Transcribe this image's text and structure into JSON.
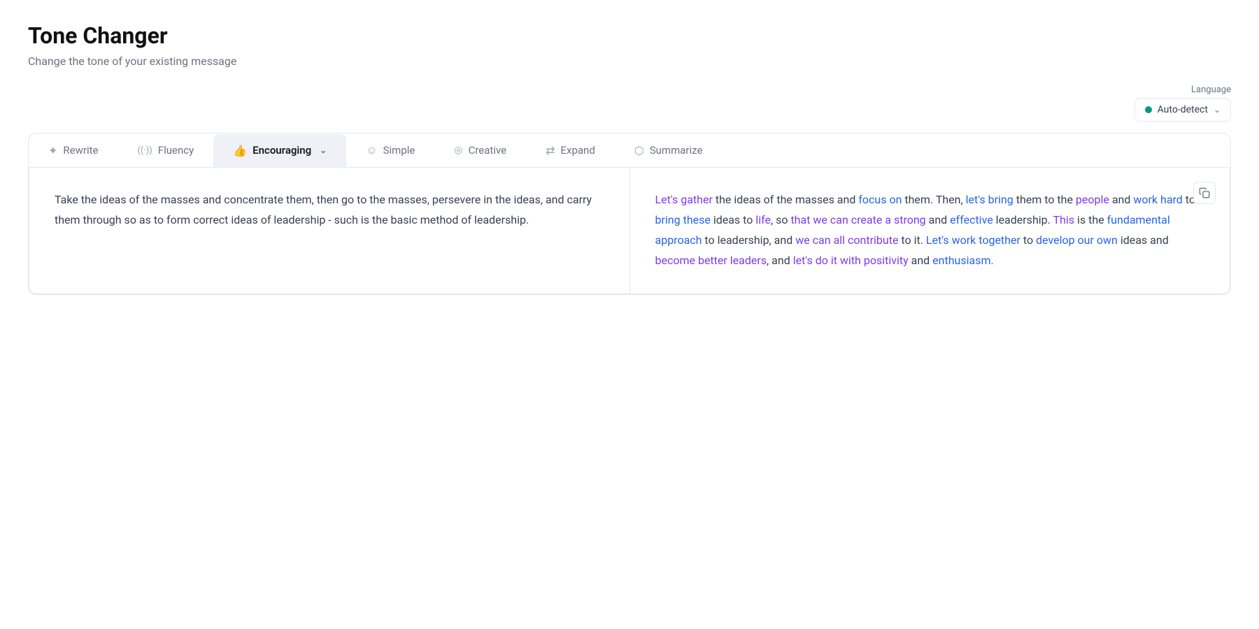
{
  "header": {
    "title": "Tone Changer",
    "subtitle": "Change the tone of your existing message"
  },
  "language": {
    "label": "Language",
    "selected": "Auto-detect",
    "dot_color": "#0d9488"
  },
  "tabs": [
    {
      "id": "rewrite",
      "label": "Rewrite",
      "icon": "✦",
      "active": false
    },
    {
      "id": "fluency",
      "label": "Fluency",
      "icon": "◉",
      "active": false
    },
    {
      "id": "encouraging",
      "label": "Encouraging",
      "icon": "👍",
      "active": true,
      "has_dropdown": true
    },
    {
      "id": "simple",
      "label": "Simple",
      "icon": "☺",
      "active": false
    },
    {
      "id": "creative",
      "label": "Creative",
      "icon": "◎",
      "active": false
    },
    {
      "id": "expand",
      "label": "Expand",
      "icon": "⇄",
      "active": false
    },
    {
      "id": "summarize",
      "label": "Summarize",
      "icon": "⬡",
      "active": false
    }
  ],
  "original": {
    "text": "Take the ideas of the masses and concentrate them, then go to the masses, persevere in the ideas, and carry them through so as to form correct ideas of leadership - such is the basic method of leadership."
  },
  "result": {
    "segments": [
      {
        "text": "Let's gather",
        "style": "purple"
      },
      {
        "text": " the ideas of the masses and ",
        "style": "normal"
      },
      {
        "text": "focus on",
        "style": "blue"
      },
      {
        "text": " them. Then, ",
        "style": "normal"
      },
      {
        "text": "let's bring",
        "style": "blue"
      },
      {
        "text": " them to the ",
        "style": "normal"
      },
      {
        "text": "people",
        "style": "purple"
      },
      {
        "text": " and ",
        "style": "normal"
      },
      {
        "text": "work hard",
        "style": "blue"
      },
      {
        "text": " to ",
        "style": "normal"
      },
      {
        "text": "bring these",
        "style": "blue"
      },
      {
        "text": " ideas to ",
        "style": "normal"
      },
      {
        "text": "life",
        "style": "purple"
      },
      {
        "text": ", so ",
        "style": "normal"
      },
      {
        "text": "that we can create a strong",
        "style": "purple"
      },
      {
        "text": " and ",
        "style": "normal"
      },
      {
        "text": "effective",
        "style": "blue"
      },
      {
        "text": " leadership. ",
        "style": "normal"
      },
      {
        "text": "This",
        "style": "purple"
      },
      {
        "text": " is the ",
        "style": "normal"
      },
      {
        "text": "fundamental approach",
        "style": "blue"
      },
      {
        "text": " to leadership, and ",
        "style": "normal"
      },
      {
        "text": "we can all contribute",
        "style": "purple"
      },
      {
        "text": " to it. ",
        "style": "normal"
      },
      {
        "text": "Let's work together",
        "style": "blue"
      },
      {
        "text": " to ",
        "style": "normal"
      },
      {
        "text": "develop our own",
        "style": "blue"
      },
      {
        "text": " ideas and ",
        "style": "normal"
      },
      {
        "text": "become better leaders",
        "style": "purple"
      },
      {
        "text": ", and ",
        "style": "normal"
      },
      {
        "text": "let's do it with positivity",
        "style": "purple"
      },
      {
        "text": " and ",
        "style": "normal"
      },
      {
        "text": "enthusiasm.",
        "style": "blue"
      }
    ]
  },
  "icons": {
    "copy": "⧉",
    "chevron_down": "∨",
    "rewrite": "✦",
    "fluency": "◉",
    "encouraging": "👍",
    "simple": "☺",
    "creative": "◎",
    "expand": "⇄",
    "summarize": "⬡"
  }
}
